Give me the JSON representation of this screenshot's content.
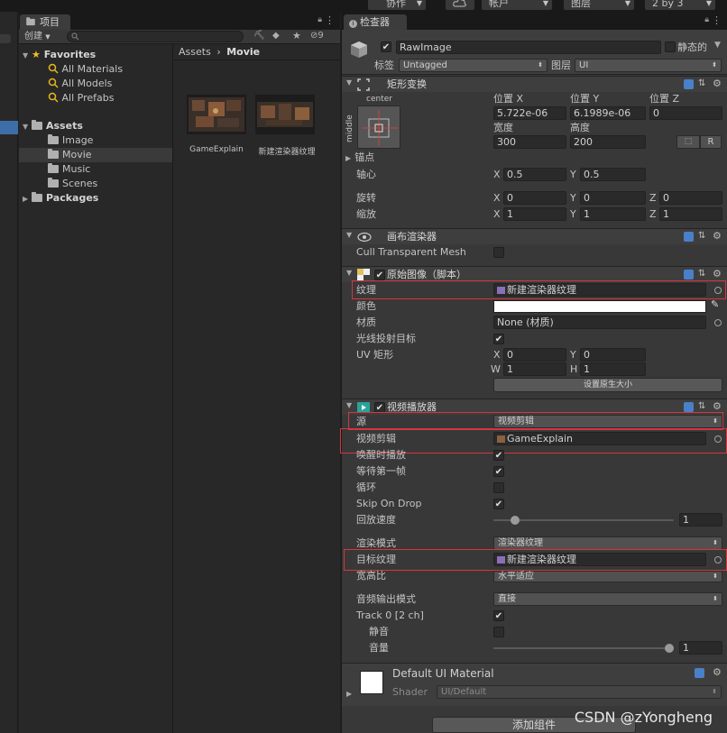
{
  "toolbar": {
    "collab_label": "协作",
    "account_label": "帐户",
    "layers_label": "图层",
    "layout_label": "2 by 3"
  },
  "project": {
    "tab_label": "项目",
    "create_label": "创建",
    "hidden_count": "9",
    "favorites": {
      "header": "Favorites",
      "items": [
        "All Materials",
        "All Models",
        "All Prefabs"
      ]
    },
    "assets": {
      "header": "Assets",
      "folders": [
        "Image",
        "Movie",
        "Music",
        "Scenes"
      ]
    },
    "packages_header": "Packages",
    "breadcrumb": {
      "root": "Assets",
      "sep": "›",
      "current": "Movie"
    },
    "files": [
      {
        "name": "GameExplain"
      },
      {
        "name": "新建渲染器纹理"
      }
    ]
  },
  "inspector": {
    "tab_label": "检查器",
    "object_name": "RawImage",
    "static_label": "静态的",
    "tag_label": "标签",
    "tag_value": "Untagged",
    "layer_label": "图层",
    "layer_value": "UI",
    "rect_transform": {
      "title": "矩形变换",
      "anchor_top": "center",
      "anchor_side": "middle",
      "pos_x_label": "位置 X",
      "pos_y_label": "位置 Y",
      "pos_z_label": "位置 Z",
      "pos_x": "5.722e-06",
      "pos_y": "6.1989e-06",
      "pos_z": "0",
      "width_label": "宽度",
      "height_label": "高度",
      "width": "300",
      "height": "200",
      "r_button": "R",
      "anchors_label": "锚点",
      "pivot_label": "轴心",
      "pivot_x": "0.5",
      "pivot_y": "0.5",
      "rotation_label": "旋转",
      "rot_x": "0",
      "rot_y": "0",
      "rot_z": "0",
      "scale_label": "缩放",
      "scale_x": "1",
      "scale_y": "1",
      "scale_z": "1",
      "x": "X",
      "y": "Y",
      "z": "Z"
    },
    "canvas_renderer": {
      "title": "画布渲染器",
      "cull_label": "Cull Transparent Mesh"
    },
    "raw_image": {
      "title": "原始图像（脚本）",
      "texture_label": "纹理",
      "texture_value": "新建渲染器纹理",
      "color_label": "颜色",
      "material_label": "材质",
      "material_value": "None (材质)",
      "raycast_label": "光线投射目标",
      "uv_label": "UV 矩形",
      "uv_x": "0",
      "uv_y": "0",
      "uv_w": "1",
      "uv_h": "1",
      "w_label": "W",
      "h_label": "H",
      "native_button": "设置原生大小"
    },
    "video_player": {
      "title": "视频播放器",
      "source_label": "源",
      "source_value": "视频剪辑",
      "clip_label": "视频剪辑",
      "clip_value": "GameExplain",
      "play_on_awake_label": "唤醒时播放",
      "wait_first_frame_label": "等待第一帧",
      "loop_label": "循环",
      "skip_on_drop_label": "Skip On Drop",
      "speed_label": "回放速度",
      "speed_value": "1",
      "speed_fraction": 0.1,
      "render_mode_label": "渲染模式",
      "render_mode_value": "渲染器纹理",
      "target_texture_label": "目标纹理",
      "target_texture_value": "新建渲染器纹理",
      "aspect_label": "宽高比",
      "aspect_value": "水平适应",
      "audio_mode_label": "音频输出模式",
      "audio_mode_value": "直接",
      "track_label": "Track 0 [2 ch]",
      "mute_label": "静音",
      "volume_label": "音量",
      "volume_value": "1",
      "volume_fraction": 1.0
    },
    "material": {
      "name": "Default UI Material",
      "shader_label": "Shader",
      "shader_value": "UI/Default"
    },
    "add_component_button": "添加组件"
  },
  "watermark": "CSDN @zYongheng",
  "colors": {
    "highlight_box": "#d6363f",
    "selection": "#3d6ea8"
  }
}
